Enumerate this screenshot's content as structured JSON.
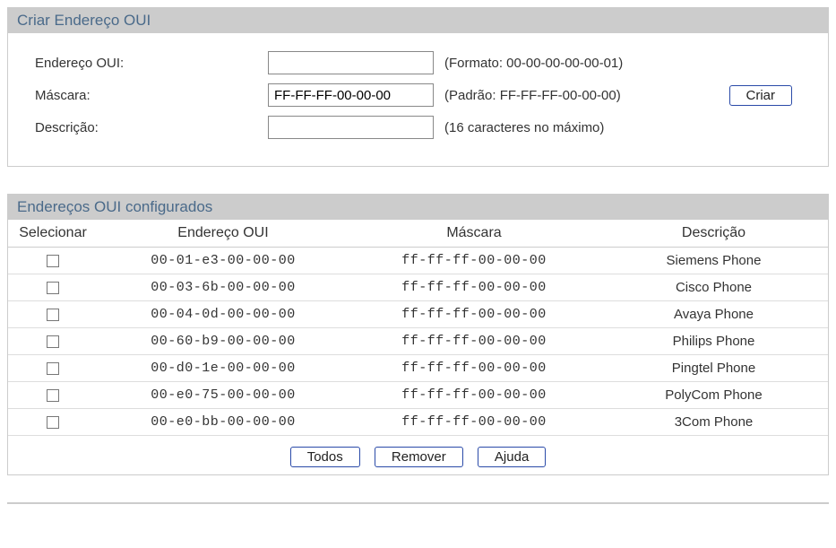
{
  "createPanel": {
    "title": "Criar Endereço OUI",
    "fields": {
      "address": {
        "label": "Endereço OUI:",
        "value": "",
        "hint": "(Formato: 00-00-00-00-00-01)"
      },
      "mask": {
        "label": "Máscara:",
        "value": "FF-FF-FF-00-00-00",
        "hint": "(Padrão: FF-FF-FF-00-00-00)"
      },
      "description": {
        "label": "Descrição:",
        "value": "",
        "hint": "(16 caracteres no máximo)"
      }
    },
    "createButton": "Criar"
  },
  "listPanel": {
    "title": "Endereços OUI configurados",
    "columns": {
      "select": "Selecionar",
      "address": "Endereço OUI",
      "mask": "Máscara",
      "description": "Descrição"
    },
    "rows": [
      {
        "address": "00-01-e3-00-00-00",
        "mask": "ff-ff-ff-00-00-00",
        "description": "Siemens Phone"
      },
      {
        "address": "00-03-6b-00-00-00",
        "mask": "ff-ff-ff-00-00-00",
        "description": "Cisco Phone"
      },
      {
        "address": "00-04-0d-00-00-00",
        "mask": "ff-ff-ff-00-00-00",
        "description": "Avaya Phone"
      },
      {
        "address": "00-60-b9-00-00-00",
        "mask": "ff-ff-ff-00-00-00",
        "description": "Philips Phone"
      },
      {
        "address": "00-d0-1e-00-00-00",
        "mask": "ff-ff-ff-00-00-00",
        "description": "Pingtel Phone"
      },
      {
        "address": "00-e0-75-00-00-00",
        "mask": "ff-ff-ff-00-00-00",
        "description": "PolyCom Phone"
      },
      {
        "address": "00-e0-bb-00-00-00",
        "mask": "ff-ff-ff-00-00-00",
        "description": "3Com Phone"
      }
    ],
    "buttons": {
      "all": "Todos",
      "remove": "Remover",
      "help": "Ajuda"
    }
  }
}
